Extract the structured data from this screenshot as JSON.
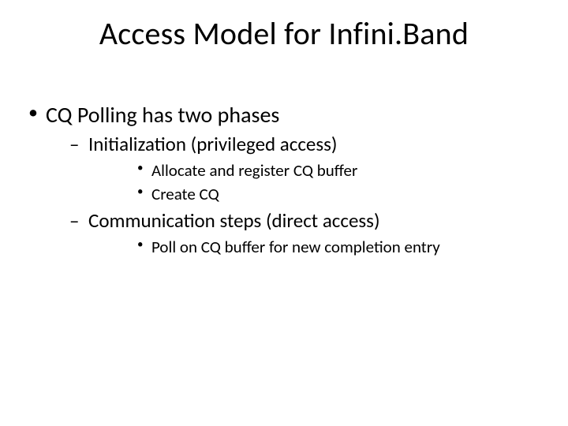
{
  "title": "Access Model for Infini.Band",
  "bullets": {
    "l1": "CQ Polling has two phases",
    "l2a": "Initialization (privileged access)",
    "l3a1": "Allocate and register CQ buffer",
    "l3a2": "Create CQ",
    "l2b": "Communication steps (direct access)",
    "l3b1": "Poll on CQ buffer for new completion entry"
  }
}
